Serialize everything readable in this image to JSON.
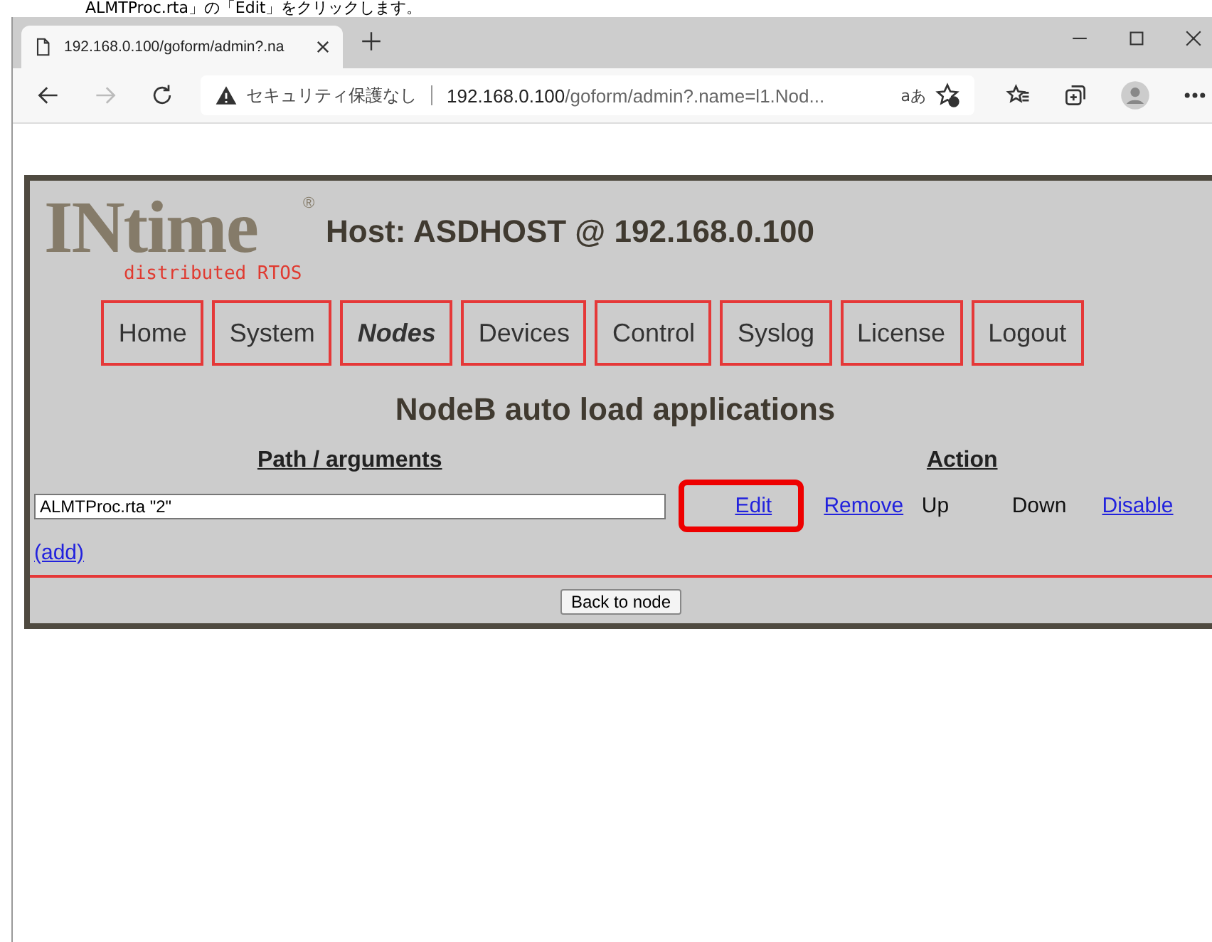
{
  "caption": "ALMTProc.rta」の「Edit」をクリックします。",
  "browser": {
    "tab": {
      "title": "192.168.0.100/goform/admin?.na"
    },
    "address": {
      "security": "セキュリティ保護なし",
      "host": "192.168.0.100",
      "path": "/goform/admin?.name=l1.Nod...",
      "read_aloud": "aあ"
    }
  },
  "page": {
    "logo": {
      "name": "INtime",
      "mark": "®",
      "tagline": "distributed RTOS"
    },
    "host_title": "Host: ASDHOST @ 192.168.0.100",
    "nav": [
      {
        "label": "Home",
        "selected": false
      },
      {
        "label": "System",
        "selected": false
      },
      {
        "label": "Nodes",
        "selected": true
      },
      {
        "label": "Devices",
        "selected": false
      },
      {
        "label": "Control",
        "selected": false
      },
      {
        "label": "Syslog",
        "selected": false
      },
      {
        "label": "License",
        "selected": false
      },
      {
        "label": "Logout",
        "selected": false
      }
    ],
    "heading": "NodeB auto load applications",
    "table": {
      "columns": [
        "Path / arguments",
        "Action"
      ],
      "rows": [
        {
          "path": "ALMTProc.rta \"2\"",
          "actions": [
            {
              "label": "Edit",
              "kind": "link",
              "highlighted": true
            },
            {
              "label": "Remove",
              "kind": "link",
              "highlighted": false
            },
            {
              "label": "Up",
              "kind": "text",
              "highlighted": false
            },
            {
              "label": "Down",
              "kind": "text",
              "highlighted": false
            },
            {
              "label": "Disable",
              "kind": "link",
              "highlighted": false
            }
          ]
        }
      ]
    },
    "add_link": "(add)",
    "back_button": "Back to node"
  }
}
